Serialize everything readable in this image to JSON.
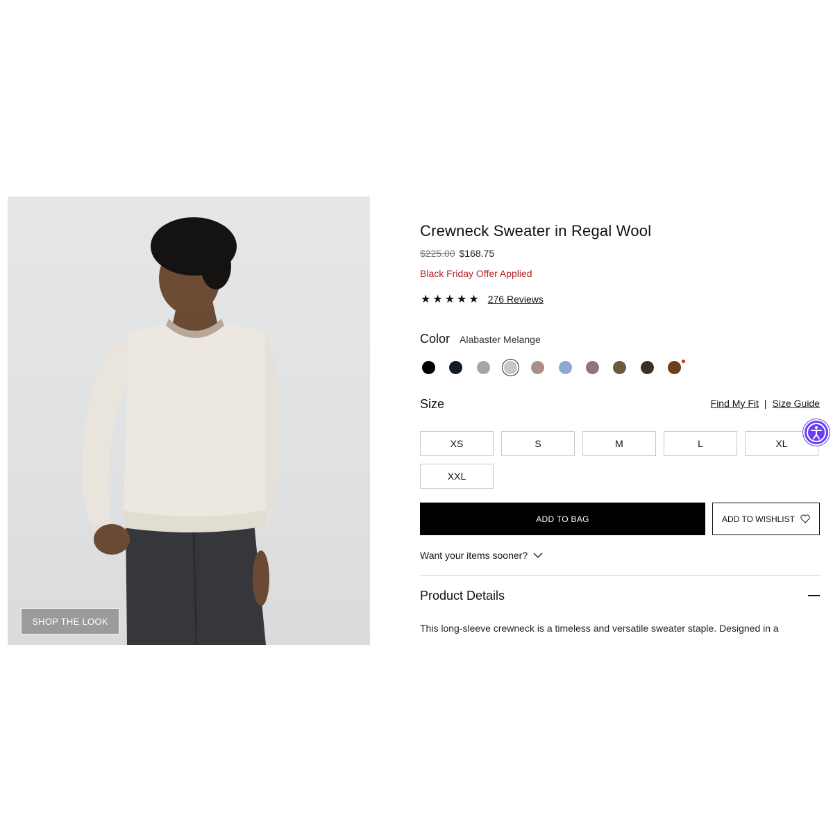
{
  "image": {
    "button_label": "SHOP THE LOOK"
  },
  "product": {
    "title": "Crewneck Sweater in Regal Wool",
    "price_original": "$225.00",
    "price_sale": "$168.75",
    "offer_text": "Black Friday Offer Applied",
    "rating": {
      "stars": "★★★★★",
      "reviews_label": "276 Reviews"
    }
  },
  "color": {
    "label": "Color",
    "selected_name": "Alabaster Melange",
    "swatches": [
      {
        "hex": "#000000"
      },
      {
        "hex": "#141a26"
      },
      {
        "hex": "#a6a6a6"
      },
      {
        "hex": "#c9c8bf",
        "selected": true
      },
      {
        "hex": "#a89183"
      },
      {
        "hex": "#8fa7d6"
      },
      {
        "hex": "#8c7480"
      },
      {
        "hex": "#6b5a35"
      },
      {
        "hex": "#3a302a"
      },
      {
        "hex": "#6b3e1e",
        "badge": true
      }
    ]
  },
  "size": {
    "label": "Size",
    "find_fit": "Find My Fit",
    "separator": "|",
    "size_guide": "Size Guide",
    "options": [
      "XS",
      "S",
      "M",
      "L",
      "XL",
      "XXL"
    ]
  },
  "actions": {
    "add_to_bag": "ADD TO BAG",
    "add_to_wishlist": "ADD TO WISHLIST"
  },
  "delivery": {
    "prompt": "Want your items sooner?"
  },
  "details": {
    "title": "Product Details",
    "text": "This long-sleeve crewneck is a timeless and versatile sweater staple. Designed in a"
  },
  "colors": {
    "offer_red": "#b22222",
    "accessibility": "#6a3ef2"
  }
}
